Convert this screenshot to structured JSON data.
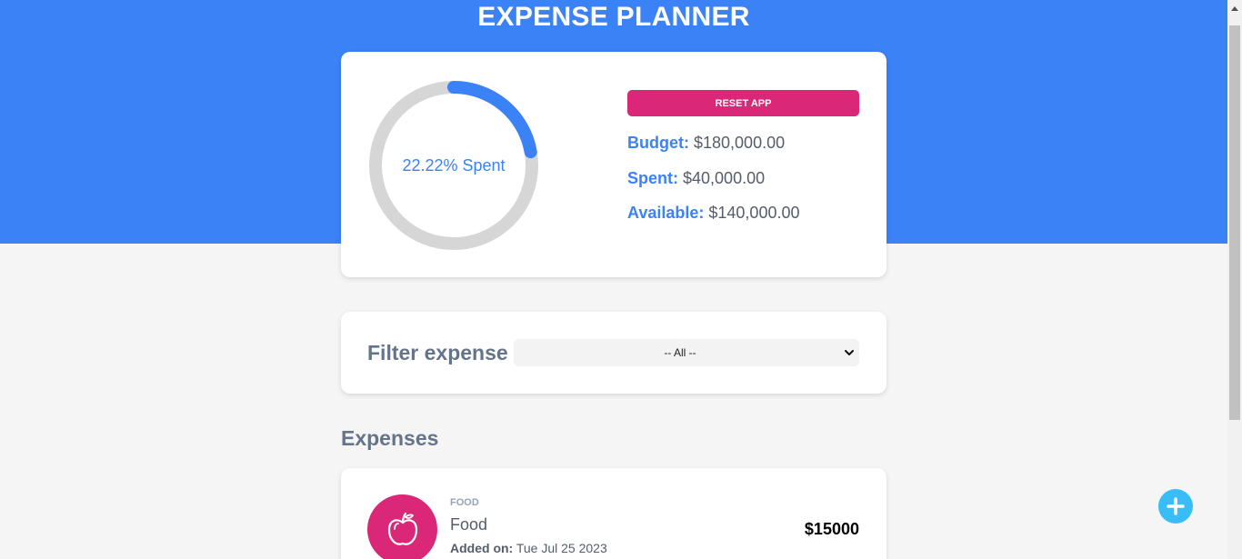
{
  "app": {
    "title": "EXPENSE PLANNER"
  },
  "budget": {
    "spent_fraction": 0.2222,
    "ring_label": "22.22% Spent",
    "reset_label": "RESET APP",
    "budget_key": "Budget:",
    "budget_value": "$180,000.00",
    "spent_key": "Spent:",
    "spent_value": "$40,000.00",
    "available_key": "Available:",
    "available_value": "$140,000.00",
    "colors": {
      "progress": "#3b82f6",
      "track": "#d6d6d6",
      "reset": "#db2777"
    }
  },
  "filter": {
    "label": "Filter expense",
    "selected": "-- All --"
  },
  "expenses": {
    "title": "Expenses",
    "items": [
      {
        "category": "FOOD",
        "name": "Food",
        "added_key": "Added on:",
        "date": "Tue Jul 25 2023",
        "amount": "$15000",
        "icon": "apple-icon",
        "icon_bg": "#db2777"
      }
    ]
  },
  "fab": {
    "icon": "plus-icon",
    "color": "#38bdf8"
  }
}
